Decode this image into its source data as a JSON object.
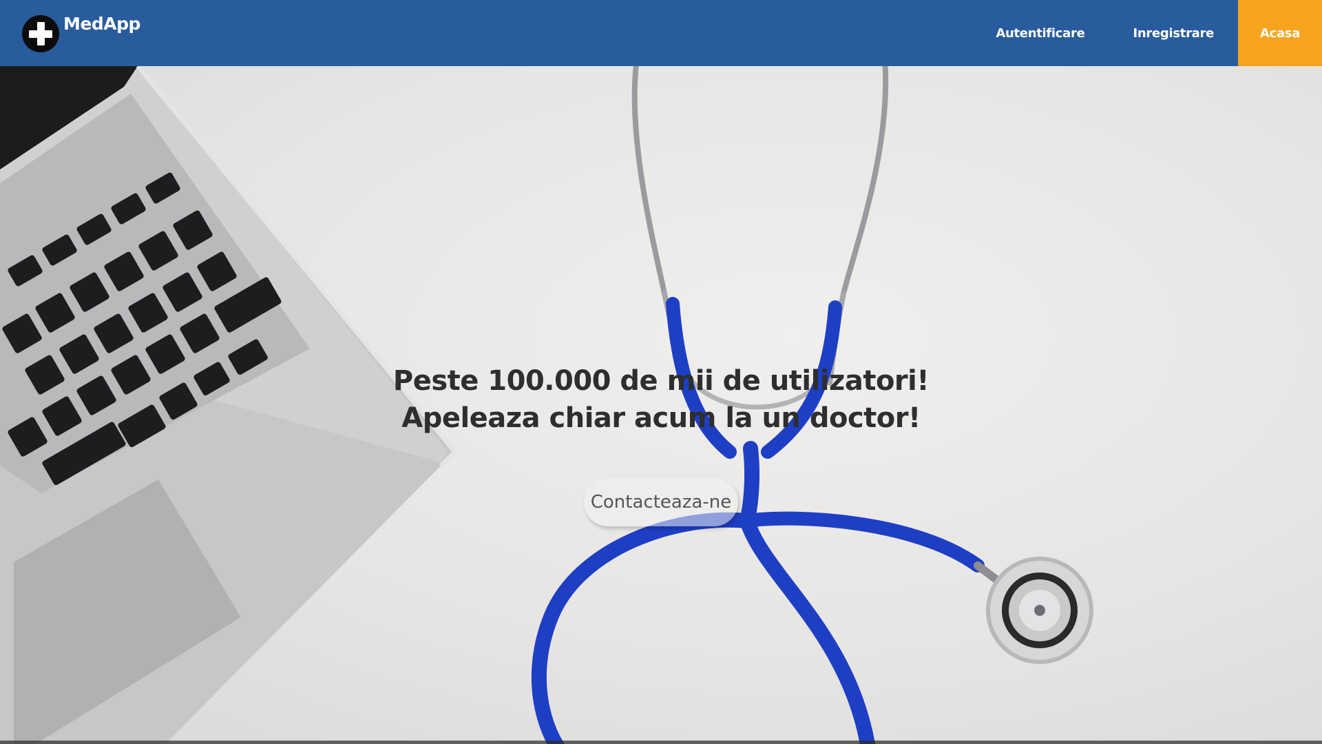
{
  "header": {
    "brand": "MedApp",
    "nav": {
      "login": "Autentificare",
      "register": "Inregistrare",
      "home": "Acasa"
    }
  },
  "hero": {
    "headline_line1": "Peste 100.000 de mii de utilizatori!",
    "headline_line2": "Apeleaza chiar acum la un doctor!",
    "cta": "Contacteaza-ne"
  },
  "colors": {
    "navbar": "#285c9c",
    "active_nav": "#f8a31e",
    "stethoscope_tube": "#1e3fc4"
  }
}
